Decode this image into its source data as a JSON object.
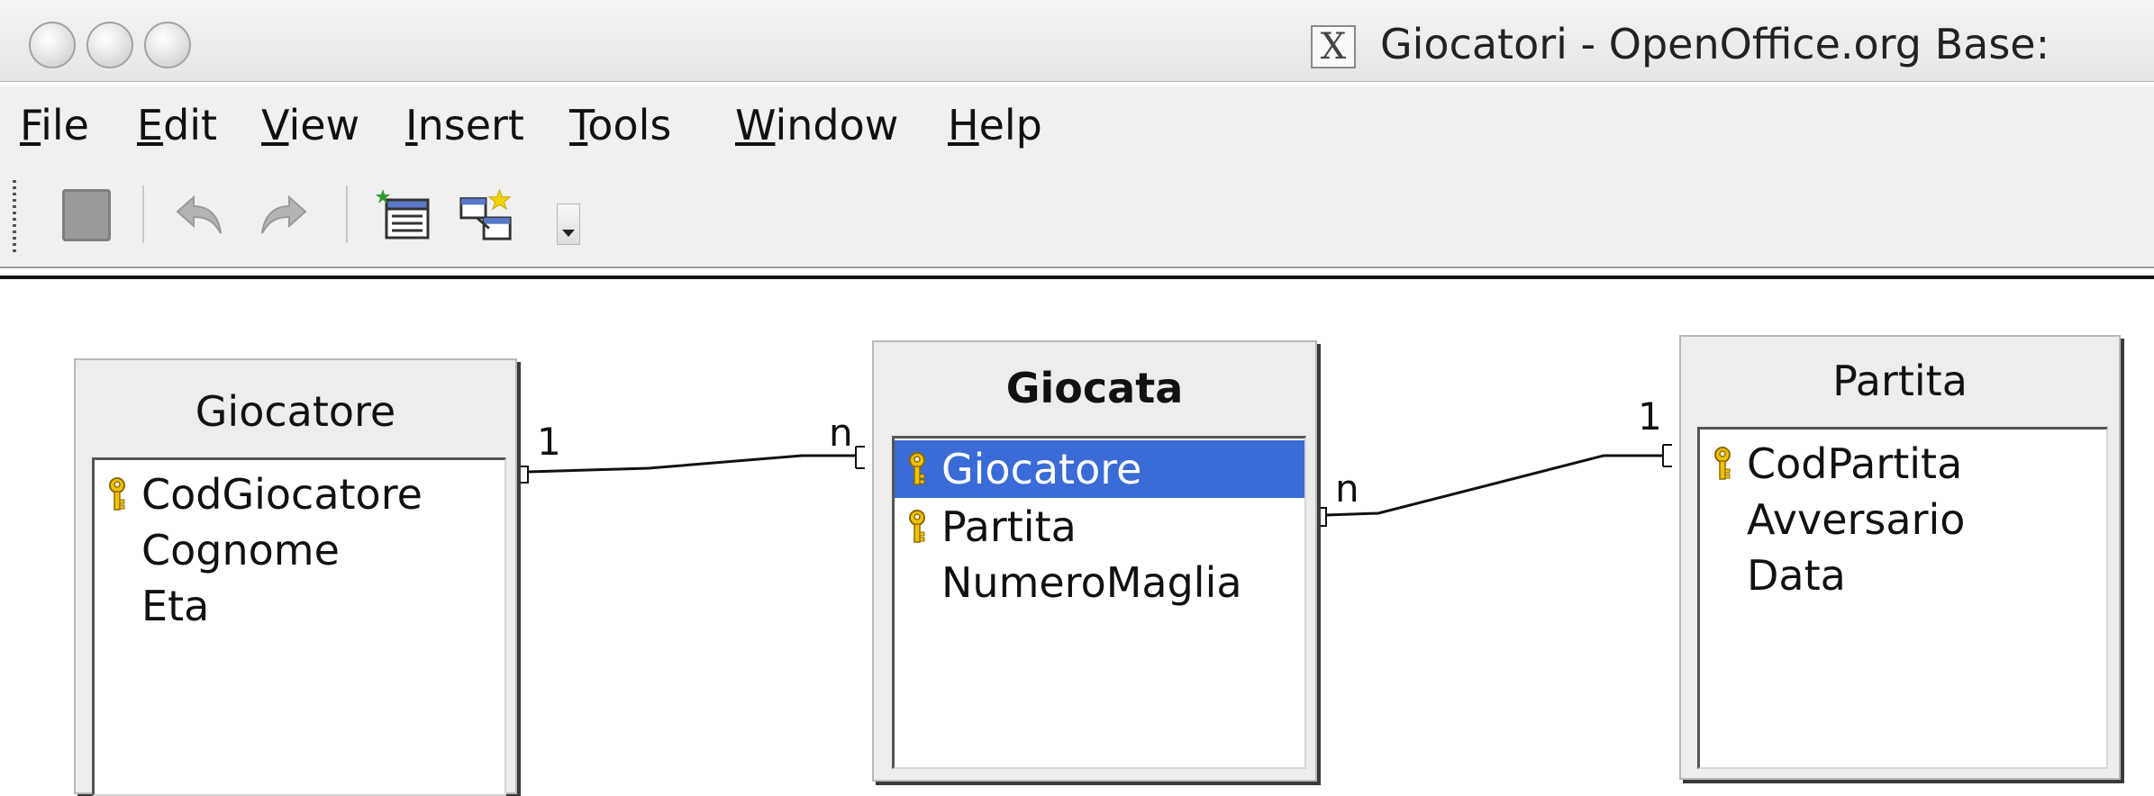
{
  "window": {
    "title": "Giocatori - OpenOffice.org Base:",
    "icon": "x-window-icon"
  },
  "menubar": {
    "items": [
      {
        "underline": "F",
        "rest": "ile"
      },
      {
        "underline": "E",
        "rest": "dit"
      },
      {
        "underline": "V",
        "rest": "iew"
      },
      {
        "underline": "I",
        "rest": "nsert"
      },
      {
        "underline": "T",
        "rest": "ools"
      },
      {
        "underline": "W",
        "rest": "indow"
      },
      {
        "underline": "H",
        "rest": "elp"
      }
    ]
  },
  "toolbar": {
    "icons": [
      "save-icon",
      "undo-icon",
      "redo-icon",
      "add-table-icon",
      "new-relation-icon",
      "toolbar-overflow-icon"
    ]
  },
  "colors": {
    "selection": "#3a6bd6",
    "key": "#e0b000"
  },
  "tables": {
    "giocatore": {
      "title": "Giocatore",
      "fields": [
        {
          "label": "CodGiocatore",
          "key": true
        },
        {
          "label": "Cognome",
          "key": false
        },
        {
          "label": "Eta",
          "key": false
        }
      ]
    },
    "giocata": {
      "title": "Giocata",
      "fields": [
        {
          "label": "Giocatore",
          "key": true,
          "selected": true
        },
        {
          "label": "Partita",
          "key": true
        },
        {
          "label": "NumeroMaglia",
          "key": false
        }
      ]
    },
    "partita": {
      "title": "Partita",
      "fields": [
        {
          "label": "CodPartita",
          "key": true
        },
        {
          "label": "Avversario",
          "key": false
        },
        {
          "label": "Data",
          "key": false
        }
      ]
    }
  },
  "relations": {
    "r1": {
      "left": "1",
      "right": "n"
    },
    "r2": {
      "left": "n",
      "right": "1"
    }
  }
}
